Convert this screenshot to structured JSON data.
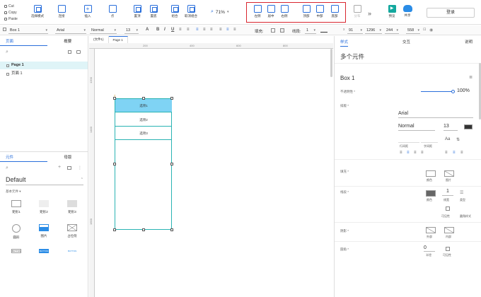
{
  "toolbar": {
    "clipboard": [
      "Cut",
      "Copy",
      "Paste"
    ],
    "buttons": [
      {
        "label": "选择模式"
      },
      {
        "label": "连接"
      },
      {
        "label": "插入"
      },
      {
        "label": "点"
      },
      {
        "label": "置顶"
      },
      {
        "label": "置底"
      },
      {
        "label": "组合"
      },
      {
        "label": "取消组合"
      }
    ],
    "zoom": "71%",
    "align": [
      "左侧",
      "居中",
      "右侧",
      "顶部",
      "中部",
      "底部"
    ],
    "extra": [
      "分布"
    ],
    "preview_label": "预览",
    "share_label": "共享",
    "login_label": "登录"
  },
  "format_bar": {
    "element_name": "Box 1",
    "font": "Arial",
    "weight": "Normal",
    "size": "13",
    "fill_label": "填充:",
    "line_label": "线段:",
    "line_value": "1",
    "x": "91",
    "y": "1296",
    "w": "244",
    "h": "558"
  },
  "left_panel": {
    "tab_pages": "页面",
    "tab_outline": "概要",
    "pages": [
      {
        "label": "Page 1"
      },
      {
        "label": "页面 1"
      }
    ],
    "tab_components": "元件",
    "tab_masters": "母版",
    "library": "Default",
    "category": "基本元件 ▾",
    "items": [
      {
        "label": "矩形1"
      },
      {
        "label": "矩形2"
      },
      {
        "label": "矩形3"
      },
      {
        "label": "圆形"
      },
      {
        "label": "图片"
      },
      {
        "label": "占位符"
      },
      {
        "label": "BUTTON"
      },
      {
        "label": "BUTTON"
      },
      {
        "label": "BUTTON"
      }
    ]
  },
  "canvas": {
    "page_tabs": [
      "(文件1)",
      "Page 1"
    ],
    "ruler_top": [
      "200",
      "400",
      "600",
      "800"
    ],
    "ruler_left": [
      "1200",
      "1400",
      "1600"
    ],
    "boxes": [
      {
        "label": "选项1"
      },
      {
        "label": "选项2"
      },
      {
        "label": "选项3"
      }
    ]
  },
  "right_panel": {
    "tab_style": "样式",
    "tab_interact": "交互",
    "tab_notes": "说明",
    "heading": "多个元件",
    "element_name": "Box 1",
    "opacity_label": "不透明性 *",
    "opacity_value": "100%",
    "font_label": "排版 *",
    "font": "Arial",
    "weight": "Normal",
    "size": "13",
    "line_spacing": "行间距",
    "char_spacing": "字间距",
    "fill_label": "填充 *",
    "fill_color": "颜色",
    "fill_image": "图片",
    "border_label": "线段 *",
    "border_color": "颜色",
    "border_width": "1",
    "border_width_label": "线宽",
    "border_type": "类型",
    "visible_label": "可见性",
    "border_style": "圆角样式",
    "shadow_label": "阴影 *",
    "shadow_outer": "外部",
    "shadow_inner": "内部",
    "corner_label": "圆角 *",
    "corner_value": "0",
    "corner_radius": "半径",
    "corner_visible": "可见性"
  }
}
